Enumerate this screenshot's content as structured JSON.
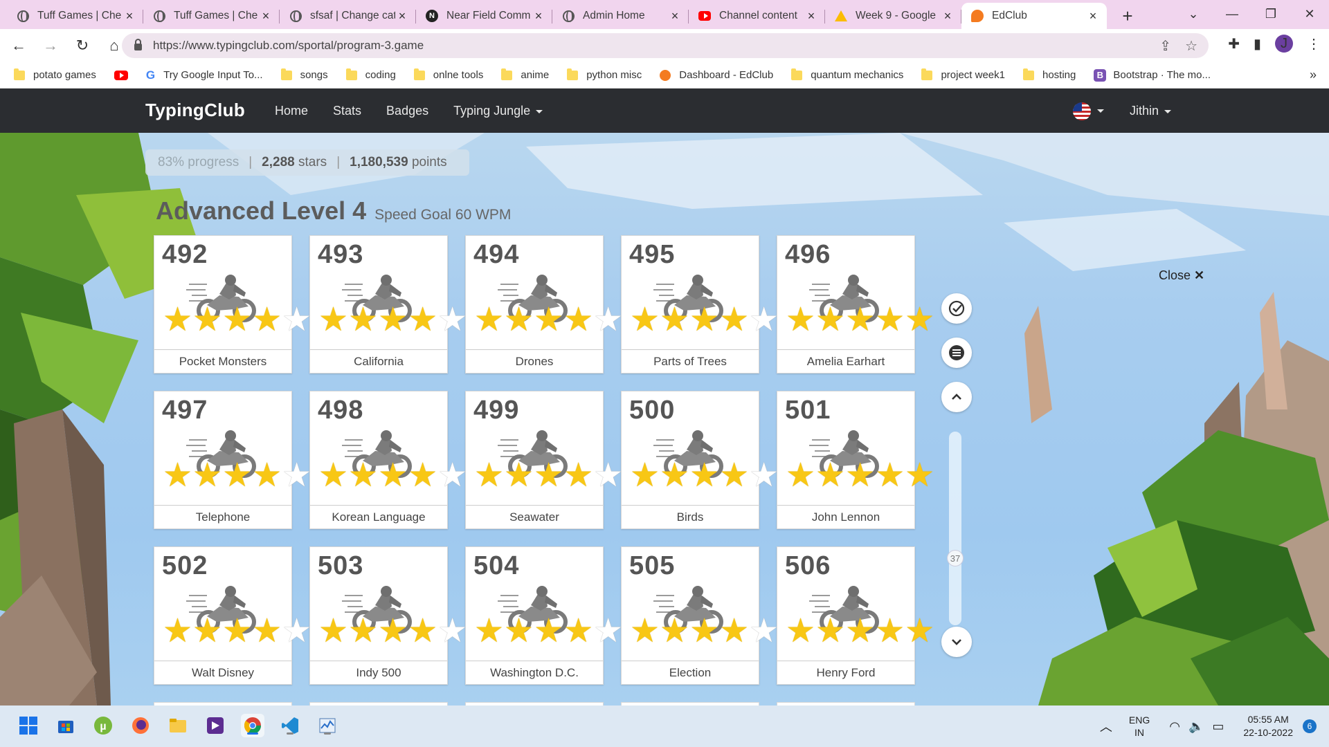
{
  "browser": {
    "tabs": [
      {
        "title": "Tuff Games | Che",
        "icon": "globe-icon",
        "active": false
      },
      {
        "title": "Tuff Games | Che",
        "icon": "globe-icon",
        "active": false
      },
      {
        "title": "sfsaf | Change cat",
        "icon": "globe-icon",
        "active": false
      },
      {
        "title": "Near Field Comm",
        "icon": "near-icon",
        "active": false
      },
      {
        "title": "Admin Home",
        "icon": "globe-icon",
        "active": false
      },
      {
        "title": "Channel content",
        "icon": "youtube-icon",
        "active": false
      },
      {
        "title": "Week 9 - Google",
        "icon": "drive-icon",
        "active": false
      },
      {
        "title": "EdClub",
        "icon": "edclub-icon",
        "active": true
      }
    ],
    "url": "https://www.typingclub.com/sportal/program-3.game",
    "profile_initial": "J",
    "bookmarks": [
      {
        "label": "potato games",
        "icon": "folder-icon"
      },
      {
        "label": "",
        "icon": "youtube-icon"
      },
      {
        "label": "Try Google Input To...",
        "icon": "google-icon"
      },
      {
        "label": "songs",
        "icon": "folder-icon"
      },
      {
        "label": "coding",
        "icon": "folder-icon"
      },
      {
        "label": "onlne tools",
        "icon": "folder-icon"
      },
      {
        "label": "anime",
        "icon": "folder-icon"
      },
      {
        "label": "python misc",
        "icon": "folder-icon"
      },
      {
        "label": "Dashboard - EdClub",
        "icon": "edclub-icon"
      },
      {
        "label": "quantum mechanics",
        "icon": "folder-icon"
      },
      {
        "label": "project week1",
        "icon": "folder-icon"
      },
      {
        "label": "hosting",
        "icon": "folder-icon"
      },
      {
        "label": "Bootstrap · The mo...",
        "icon": "bootstrap-icon"
      }
    ],
    "bookmarks_more": "»"
  },
  "site": {
    "brand": "TypingClub",
    "nav": [
      "Home",
      "Stats",
      "Badges",
      "Typing Jungle"
    ],
    "user": "Jithin"
  },
  "progress": {
    "percent_label": "83% progress",
    "stars": "2,288",
    "stars_label": "stars",
    "points": "1,180,539",
    "points_label": "points"
  },
  "level": {
    "title": "Advanced Level 4",
    "goal": "Speed Goal 60 WPM"
  },
  "lessons": [
    {
      "num": "492",
      "name": "Pocket Monsters",
      "stars": 4
    },
    {
      "num": "493",
      "name": "California",
      "stars": 4
    },
    {
      "num": "494",
      "name": "Drones",
      "stars": 4
    },
    {
      "num": "495",
      "name": "Parts of Trees",
      "stars": 4
    },
    {
      "num": "496",
      "name": "Amelia Earhart",
      "stars": 5
    },
    {
      "num": "497",
      "name": "Telephone",
      "stars": 4
    },
    {
      "num": "498",
      "name": "Korean Language",
      "stars": 4
    },
    {
      "num": "499",
      "name": "Seawater",
      "stars": 4
    },
    {
      "num": "500",
      "name": "Birds",
      "stars": 4
    },
    {
      "num": "501",
      "name": "John Lennon",
      "stars": 5
    },
    {
      "num": "502",
      "name": "Walt Disney",
      "stars": 4
    },
    {
      "num": "503",
      "name": "Indy 500",
      "stars": 4
    },
    {
      "num": "504",
      "name": "Washington D.C.",
      "stars": 4
    },
    {
      "num": "505",
      "name": "Election",
      "stars": 4
    },
    {
      "num": "506",
      "name": "Henry Ford",
      "stars": 5
    }
  ],
  "side": {
    "scroll_value": "37",
    "close_label": "Close"
  },
  "taskbar": {
    "lang_top": "ENG",
    "lang_bottom": "IN",
    "time": "05:55 AM",
    "date": "22-10-2022",
    "notifications": "6"
  },
  "colors": {
    "navbar": "#2b2d31",
    "star_on": "#f8c715",
    "sky": "#a8cdef"
  }
}
